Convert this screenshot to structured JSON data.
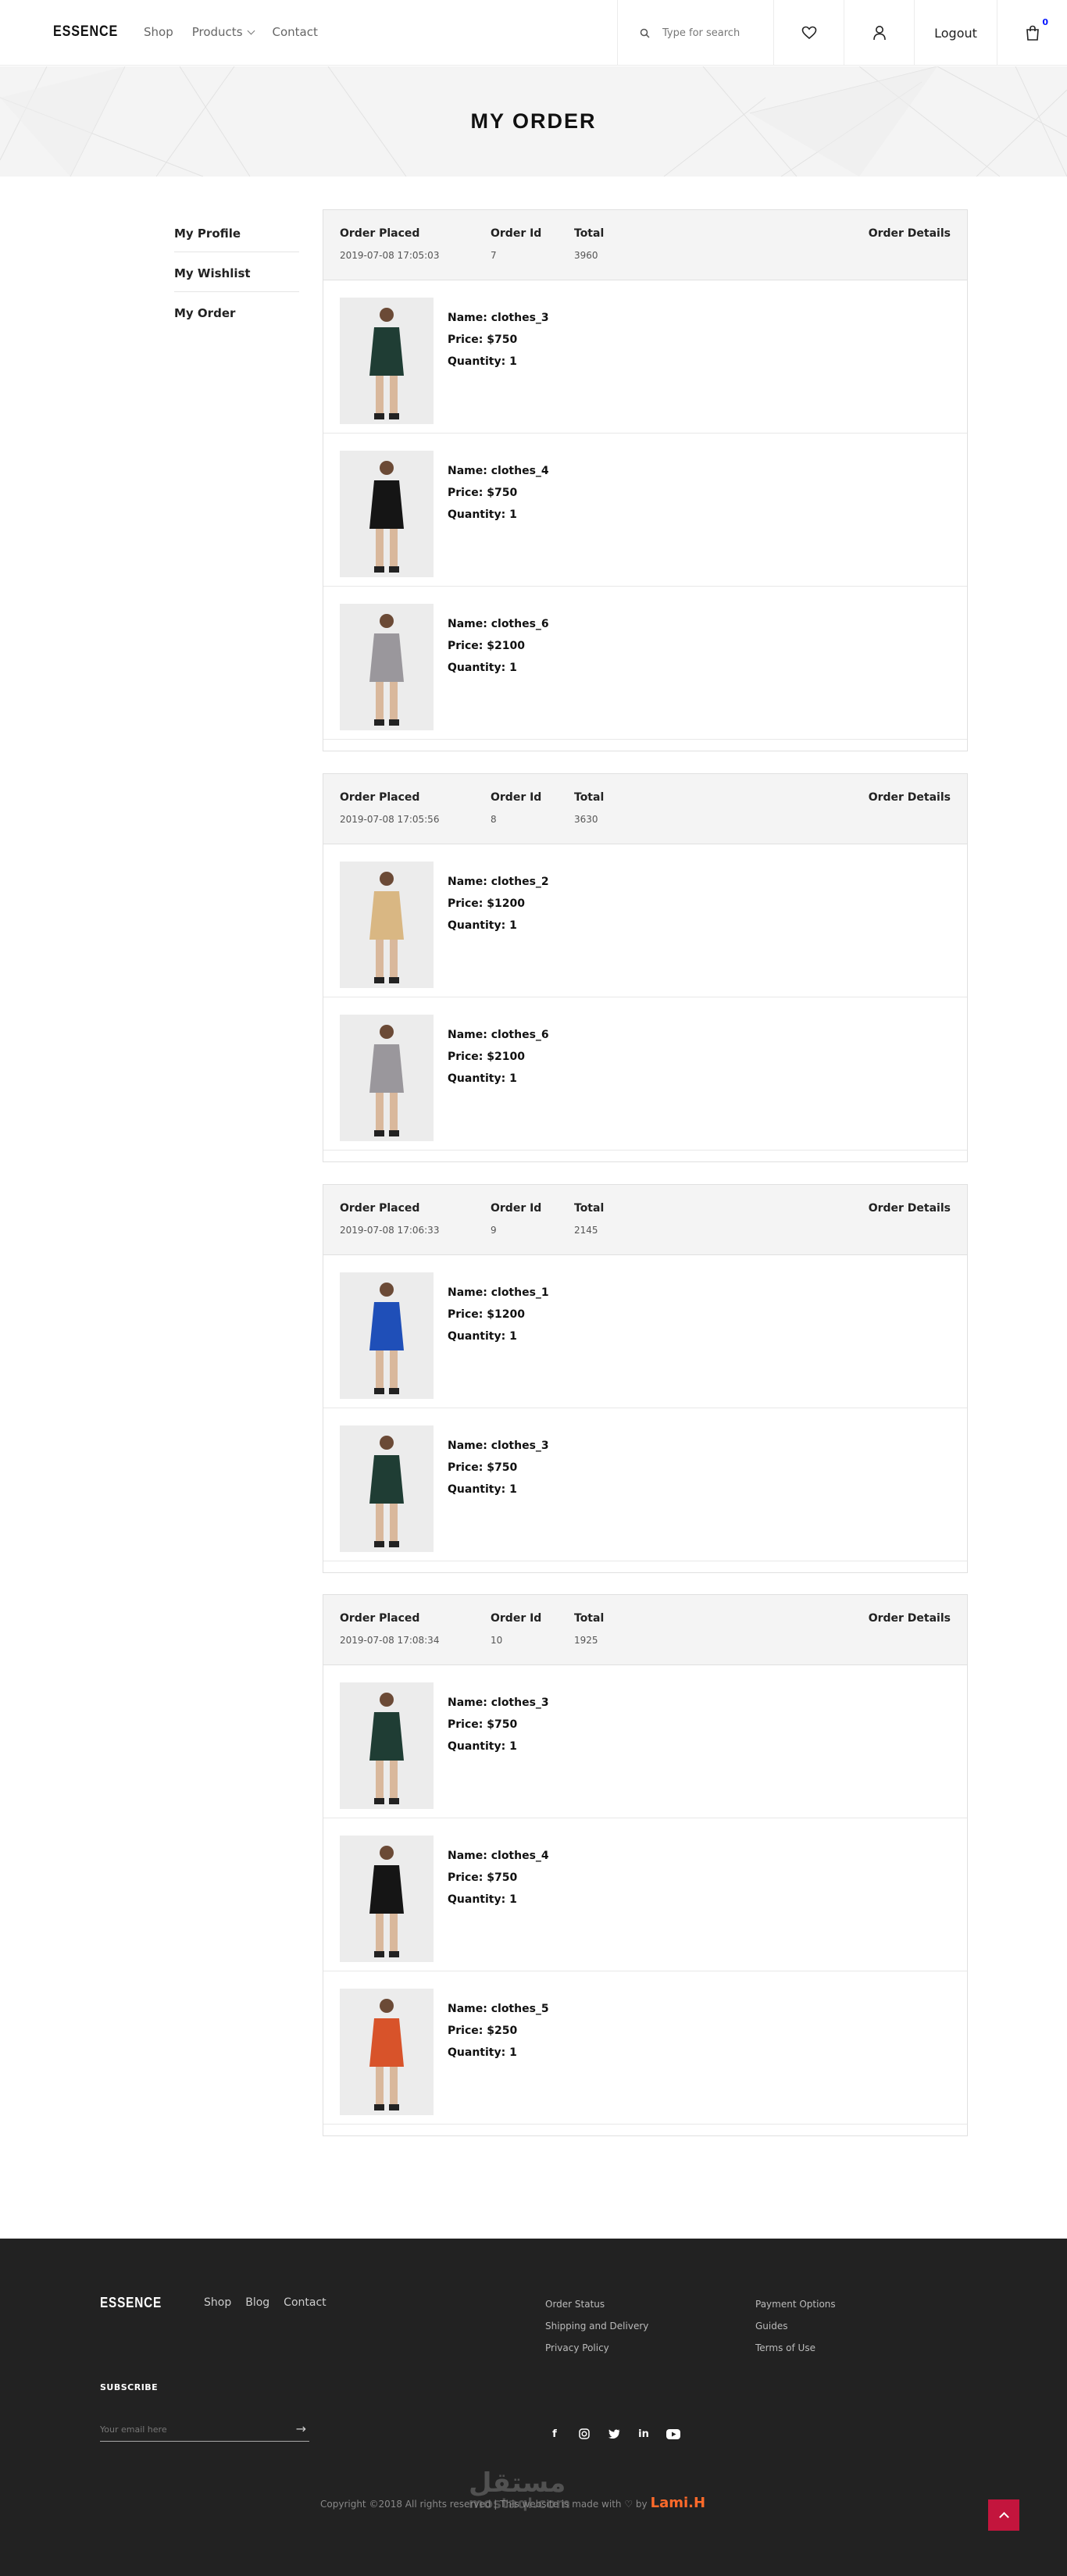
{
  "header": {
    "logo": "ESSENCE",
    "nav": {
      "shop": "Shop",
      "products": "Products",
      "contact": "Contact"
    },
    "search_placeholder": "Type for search",
    "logout": "Logout",
    "cart_count": "0"
  },
  "hero": {
    "title": "MY ORDER"
  },
  "sidebar": {
    "items": [
      {
        "label": "My Profile"
      },
      {
        "label": "My Wishlist"
      },
      {
        "label": "My Order"
      }
    ]
  },
  "order_labels": {
    "placed": "Order Placed",
    "id": "Order Id",
    "total": "Total",
    "details": "Order Details"
  },
  "orders": [
    {
      "placed": "2019-07-08 17:05:03",
      "id": "7",
      "total": "3960",
      "items": [
        {
          "name": "Name: clothes_3",
          "price": "Price: $750",
          "qty": "Quantity: 1",
          "color": "#1f3d34"
        },
        {
          "name": "Name: clothes_4",
          "price": "Price: $750",
          "qty": "Quantity: 1",
          "color": "#151515"
        },
        {
          "name": "Name: clothes_6",
          "price": "Price: $2100",
          "qty": "Quantity: 1",
          "color": "#9a979c"
        }
      ]
    },
    {
      "placed": "2019-07-08 17:05:56",
      "id": "8",
      "total": "3630",
      "items": [
        {
          "name": "Name: clothes_2",
          "price": "Price: $1200",
          "qty": "Quantity: 1",
          "color": "#d9b783"
        },
        {
          "name": "Name: clothes_6",
          "price": "Price: $2100",
          "qty": "Quantity: 1",
          "color": "#9a979c"
        }
      ]
    },
    {
      "placed": "2019-07-08 17:06:33",
      "id": "9",
      "total": "2145",
      "items": [
        {
          "name": "Name: clothes_1",
          "price": "Price: $1200",
          "qty": "Quantity: 1",
          "color": "#1f4fb8"
        },
        {
          "name": "Name: clothes_3",
          "price": "Price: $750",
          "qty": "Quantity: 1",
          "color": "#1f3d34"
        }
      ]
    },
    {
      "placed": "2019-07-08 17:08:34",
      "id": "10",
      "total": "1925",
      "items": [
        {
          "name": "Name: clothes_3",
          "price": "Price: $750",
          "qty": "Quantity: 1",
          "color": "#1f3d34"
        },
        {
          "name": "Name: clothes_4",
          "price": "Price: $750",
          "qty": "Quantity: 1",
          "color": "#151515"
        },
        {
          "name": "Name: clothes_5",
          "price": "Price: $250",
          "qty": "Quantity: 1",
          "color": "#d8532a"
        }
      ]
    }
  ],
  "footer": {
    "logo": "ESSENCE",
    "nav": {
      "shop": "Shop",
      "blog": "Blog",
      "contact": "Contact"
    },
    "col1": [
      "Order Status",
      "Shipping and Delivery",
      "Privacy Policy"
    ],
    "col2": [
      "Payment Options",
      "Guides",
      "Terms of Use"
    ],
    "subscribe": "SUBSCRIBE",
    "email_placeholder": "Your email here",
    "copyright": "Copyright ©2018 All rights reserved | This website is made with ♡ by",
    "author": "Lami.H",
    "watermark": "مستقل",
    "watermark_sub": "mostaql.com"
  },
  "icons": [
    "search-icon",
    "heart-icon",
    "user-icon",
    "cart-icon",
    "facebook-icon",
    "instagram-icon",
    "twitter-icon",
    "linkedin-icon",
    "youtube-icon",
    "arrow-right-icon",
    "chevron-up-icon"
  ],
  "colors": {
    "accent_badge": "#0315ff",
    "top_button": "#c3153d",
    "author": "#ff6a2a",
    "footer_bg": "#222222"
  }
}
